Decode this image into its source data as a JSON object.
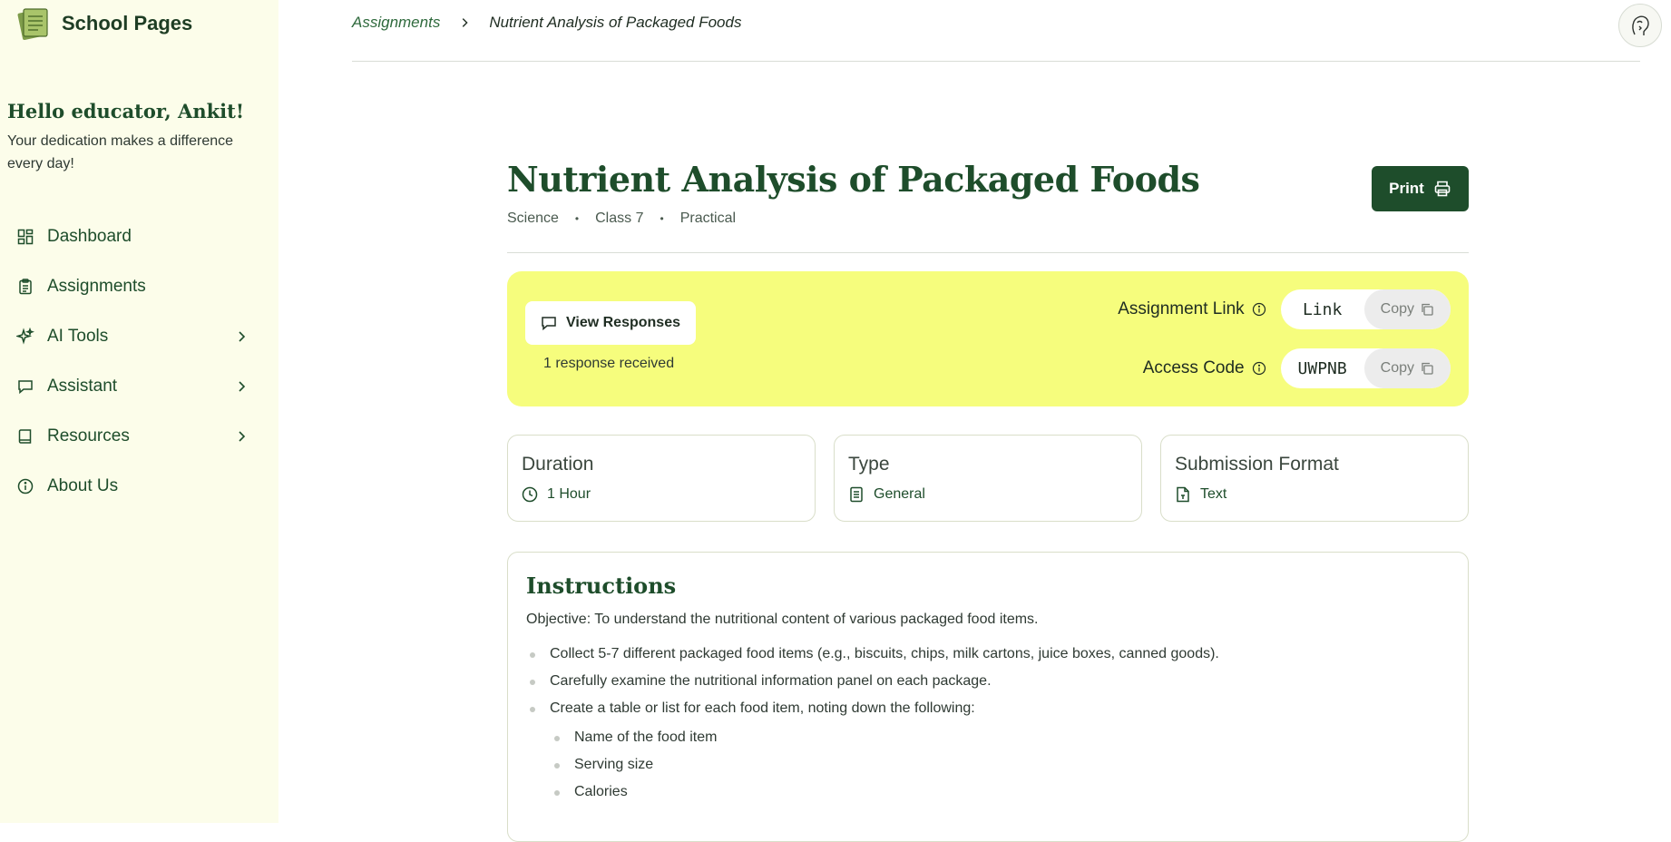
{
  "app": {
    "name": "School Pages"
  },
  "greeting": {
    "title": "Hello educator, Ankit!",
    "subtitle": "Your dedication makes a difference every day!"
  },
  "nav": [
    {
      "label": "Dashboard",
      "icon": "dashboard-icon"
    },
    {
      "label": "Assignments",
      "icon": "clipboard-icon"
    },
    {
      "label": "AI Tools",
      "icon": "sparkles-icon",
      "chevron": true
    },
    {
      "label": "Assistant",
      "icon": "message-icon",
      "chevron": true
    },
    {
      "label": "Resources",
      "icon": "book-icon",
      "chevron": true
    },
    {
      "label": "About Us",
      "icon": "info-icon"
    }
  ],
  "breadcrumb": {
    "parent": "Assignments",
    "current": "Nutrient Analysis of Packaged Foods"
  },
  "assignment": {
    "title": "Nutrient Analysis of Packaged Foods",
    "subject": "Science",
    "class": "Class 7",
    "category": "Practical",
    "print_label": "Print"
  },
  "share": {
    "view_responses_label": "View Responses",
    "responses_text": "1 response received",
    "link_label": "Assignment Link",
    "link_value": "Link",
    "access_label": "Access Code",
    "access_value": "UWPNB",
    "copy_label": "Copy"
  },
  "details": [
    {
      "title": "Duration",
      "value": "1 Hour",
      "icon": "clock-icon"
    },
    {
      "title": "Type",
      "value": "General",
      "icon": "document-icon"
    },
    {
      "title": "Submission Format",
      "value": "Text",
      "icon": "file-text-icon"
    }
  ],
  "instructions": {
    "heading": "Instructions",
    "objective": "Objective: To understand the nutritional content of various packaged food items.",
    "steps": [
      "Collect 5-7 different packaged food items (e.g., biscuits, chips, milk cartons, juice boxes, canned goods).",
      "Carefully examine the nutritional information panel on each package.",
      "Create a table or list for each food item, noting down the following:"
    ],
    "substeps": [
      "Name of the food item",
      "Serving size",
      "Calories"
    ]
  },
  "colors": {
    "brand": "#1e4d2b",
    "highlight": "#f6fd7d",
    "sidebar": "#fcfdea"
  }
}
